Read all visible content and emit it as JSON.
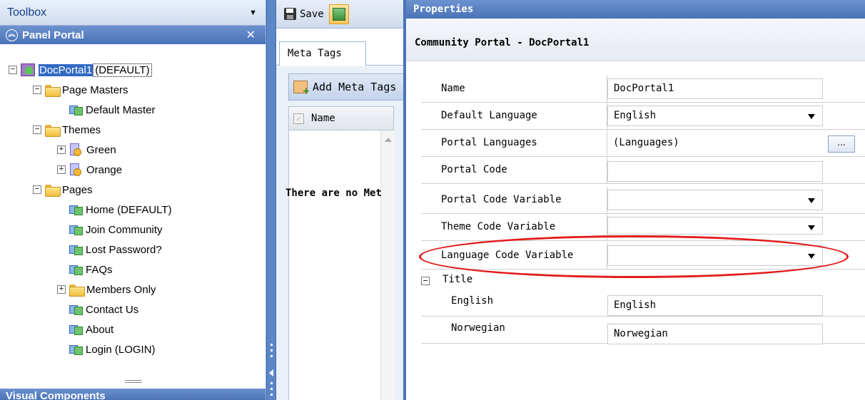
{
  "toolbox": {
    "title": "Toolbox",
    "panel_title": "Panel Portal",
    "bottom_panel_title": "Visual Components",
    "tree": {
      "portal_name": "DocPortal1",
      "portal_suffix": "(DEFAULT)",
      "page_masters_label": "Page Masters",
      "default_master_label": "Default Master",
      "themes_label": "Themes",
      "themes": [
        "Green",
        "Orange"
      ],
      "pages_label": "Pages",
      "pages": [
        "Home (DEFAULT)",
        "Join Community",
        "Lost Password?",
        "FAQs",
        "Members Only",
        "Contact Us",
        "About",
        "Login (LOGIN)"
      ]
    }
  },
  "middle": {
    "save_label": "Save",
    "tab_label": "Meta Tags",
    "add_meta_label": "Add Meta Tags",
    "column_name": "Name",
    "empty_text": "There are no Meta Tags"
  },
  "properties": {
    "header": "Properties",
    "subtitle": "Community Portal - DocPortal1",
    "rows": [
      {
        "label": "Name",
        "value": "DocPortal1",
        "type": "text"
      },
      {
        "label": "Default Language",
        "value": "English",
        "type": "select"
      },
      {
        "label": "Portal Languages",
        "value": "(Languages)",
        "type": "collection"
      },
      {
        "label": "Portal Code",
        "value": "",
        "type": "text"
      },
      {
        "label": "Portal Code Variable",
        "value": "",
        "type": "select"
      },
      {
        "label": "Theme Code Variable",
        "value": "",
        "type": "select"
      },
      {
        "label": "Language Code Variable",
        "value": "",
        "type": "select"
      }
    ],
    "ellipsis_label": "...",
    "title_group": {
      "label": "Title",
      "items": [
        {
          "label": "English",
          "value": "English"
        },
        {
          "label": "Norwegian",
          "value": "Norwegian"
        }
      ]
    }
  },
  "colors": {
    "header_blue": "#4a73b8",
    "selection_blue": "#316ac5",
    "highlight_red": "#e21b1b"
  }
}
